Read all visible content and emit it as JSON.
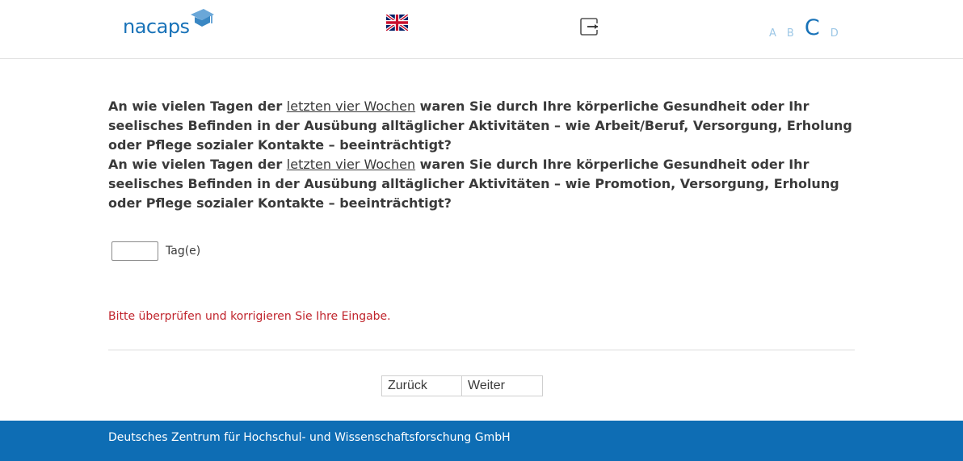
{
  "header": {
    "logo_text": "nacaps",
    "language_flag": "uk-flag-icon",
    "logout_icon": "logout-icon",
    "font_sizes": [
      "A",
      "B",
      "C",
      "D"
    ],
    "active_font_size": "C"
  },
  "question": {
    "line1": {
      "pre": "An wie vielen Tagen der ",
      "underline": "letzten vier Wochen",
      "post": " waren Sie durch Ihre körperliche Gesundheit oder Ihr seelisches Befinden in der Ausübung alltäglicher Aktivitäten – wie Arbeit/Beruf, Versorgung, Erholung oder Pflege sozialer Kontakte – beeinträchtigt?"
    },
    "line2": {
      "pre": "An wie vielen Tagen der ",
      "underline": "letzten vier Wochen",
      "post": " waren Sie durch Ihre körperliche Gesundheit oder Ihr seelisches Befinden in der Ausübung alltäglicher Aktivitäten – wie Promotion, Versorgung, Erholung oder Pflege sozialer Kontakte – beeinträchtigt?"
    }
  },
  "answer": {
    "value": "",
    "unit": "Tag(e)"
  },
  "error_message": "Bitte überprüfen und korrigieren Sie Ihre Eingabe.",
  "navigation": {
    "back_label": "Zurück",
    "next_label": "Weiter"
  },
  "footer": {
    "text": "Deutsches Zentrum für Hochschul- und Wissenschaftsforschung GmbH"
  },
  "colors": {
    "brand": "#1872b8",
    "footer_bg": "#0e6db4",
    "error": "#c0242c"
  }
}
